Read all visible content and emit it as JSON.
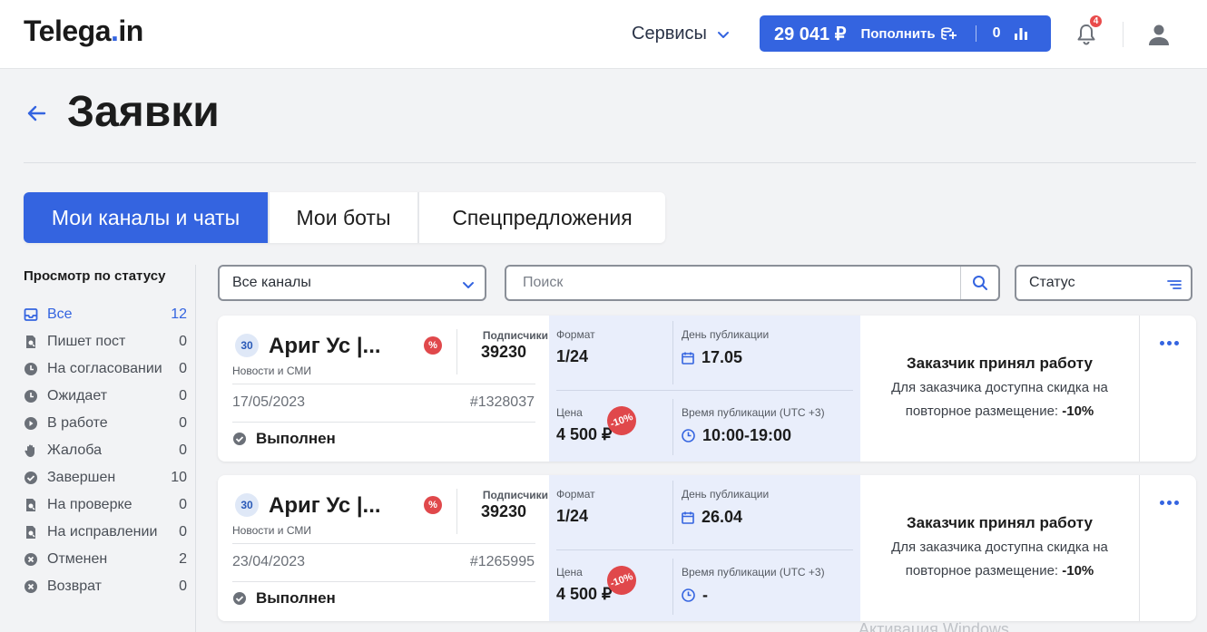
{
  "header": {
    "logo_main": "Telega",
    "logo_dot": ".",
    "logo_tld": "in",
    "services_label": "Сервисы",
    "balance": "29 041 ₽",
    "topup_label": "Пополнить",
    "counter": "0",
    "notifications": "4",
    "accent": "#3464e0"
  },
  "page": {
    "title": "Заявки"
  },
  "tabs": [
    {
      "label": "Мои каналы и чаты",
      "active": true
    },
    {
      "label": "Мои боты",
      "active": false
    },
    {
      "label": "Спецпредложения",
      "active": false
    }
  ],
  "sidebar": {
    "title": "Просмотр по статусу",
    "items": [
      {
        "label": "Все",
        "count": "12",
        "icon": "inbox-icon"
      },
      {
        "label": "Пишет пост",
        "count": "0",
        "icon": "doc-search-icon"
      },
      {
        "label": "На согласовании",
        "count": "0",
        "icon": "clock-icon"
      },
      {
        "label": "Ожидает",
        "count": "0",
        "icon": "clock-icon"
      },
      {
        "label": "В работе",
        "count": "0",
        "icon": "play-icon"
      },
      {
        "label": "Жалоба",
        "count": "0",
        "icon": "hand-icon"
      },
      {
        "label": "Завершен",
        "count": "10",
        "icon": "check-circle-icon"
      },
      {
        "label": "На проверке",
        "count": "0",
        "icon": "doc-search-icon"
      },
      {
        "label": "На исправлении",
        "count": "0",
        "icon": "doc-search-icon"
      },
      {
        "label": "Отменен",
        "count": "2",
        "icon": "x-circle-icon"
      },
      {
        "label": "Возврат",
        "count": "0",
        "icon": "x-circle-icon"
      }
    ]
  },
  "filters": {
    "channels_value": "Все каналы",
    "search_placeholder": "Поиск",
    "status_value": "Статус"
  },
  "orders": [
    {
      "channel_icon_text": "30",
      "channel_name": "Ариг Ус |...",
      "category": "Новости и СМИ",
      "subscribers_label": "Подписчики",
      "subscribers": "39230",
      "date": "17/05/2023",
      "order_id": "#1328037",
      "state": "Выполнен",
      "format_label": "Формат",
      "format": "1/24",
      "pub_day_label": "День публикации",
      "pub_day": "17.05",
      "price_label": "Цена",
      "price": "4 500 ₽",
      "discount": "-10%",
      "pub_time_label": "Время публикации (UTC +3)",
      "pub_time": "10:00-19:00",
      "result_title": "Заказчик принял работу",
      "result_text": "Для заказчика доступна скидка на повторное размещение: ",
      "result_discount": "-10%"
    },
    {
      "channel_icon_text": "30",
      "channel_name": "Ариг Ус |...",
      "category": "Новости и СМИ",
      "subscribers_label": "Подписчики",
      "subscribers": "39230",
      "date": "23/04/2023",
      "order_id": "#1265995",
      "state": "Выполнен",
      "format_label": "Формат",
      "format": "1/24",
      "pub_day_label": "День публикации",
      "pub_day": "26.04",
      "price_label": "Цена",
      "price": "4 500 ₽",
      "discount": "-10%",
      "pub_time_label": "Время публикации (UTC +3)",
      "pub_time": "-",
      "result_title": "Заказчик принял работу",
      "result_text": "Для заказчика доступна скидка на повторное размещение: ",
      "result_discount": "-10%"
    }
  ],
  "watermark": "Активация Windows"
}
